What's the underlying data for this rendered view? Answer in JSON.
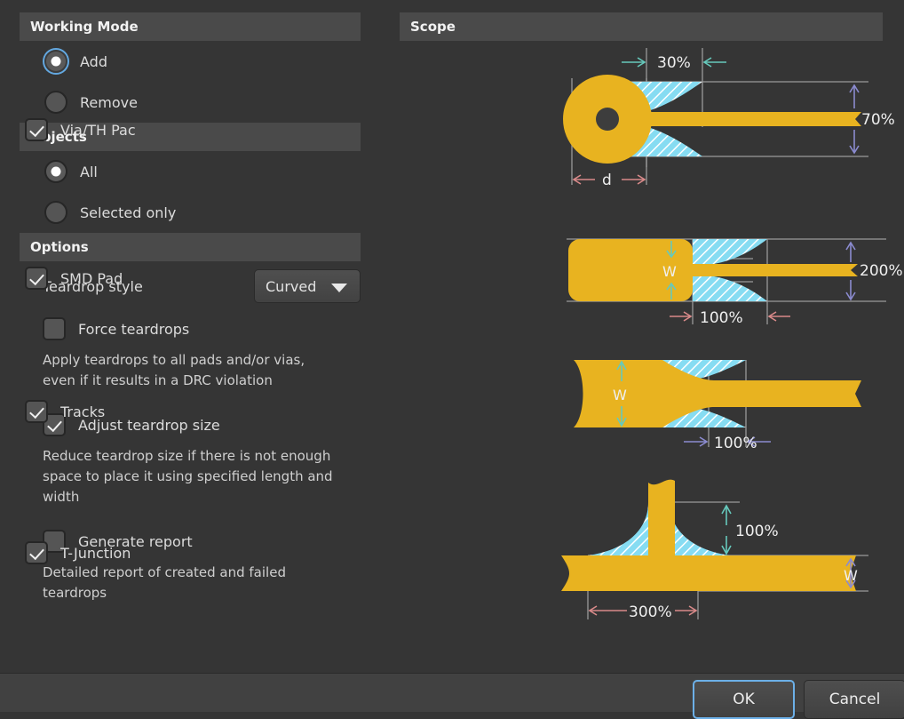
{
  "working_mode": {
    "header": "Working Mode",
    "options": [
      {
        "label": "Add",
        "selected": true,
        "focused": true
      },
      {
        "label": "Remove",
        "selected": false,
        "focused": false
      }
    ]
  },
  "objects": {
    "header": "Objects",
    "options": [
      {
        "label": "All",
        "selected": true,
        "focused": false
      },
      {
        "label": "Selected only",
        "selected": false,
        "focused": false
      }
    ]
  },
  "options": {
    "header": "Options",
    "teardrop_style": {
      "label": "Teardrop style",
      "value": "Curved",
      "caret_icon": "chevron-down-icon"
    },
    "force_teardrops": {
      "label": "Force teardrops",
      "checked": false,
      "help": "Apply teardrops to all pads and/or vias, even if it results in a DRC violation"
    },
    "adjust_teardrop_size": {
      "label": "Adjust teardrop size",
      "checked": true,
      "help": "Reduce teardrop size if there is not enough space to place it using specified length and width"
    },
    "generate_report": {
      "label": "Generate report",
      "checked": false,
      "help": "Detailed report of created and failed teardrops"
    }
  },
  "scope": {
    "header": "Scope",
    "items": [
      {
        "key": "via_th_pad",
        "label": "Via/TH Pac",
        "checked": true,
        "figure": "via-th-pad-diagram",
        "annotations": {
          "horizontal": "30%",
          "vertical": "70%",
          "diameter": "d"
        }
      },
      {
        "key": "smd_pad",
        "label": "SMD Pad",
        "checked": true,
        "figure": "smd-pad-diagram",
        "annotations": {
          "horizontal": "100%",
          "vertical": "200%",
          "width": "W"
        }
      },
      {
        "key": "tracks",
        "label": "Tracks",
        "checked": true,
        "figure": "tracks-diagram",
        "annotations": {
          "horizontal": "100%",
          "width": "W"
        }
      },
      {
        "key": "t_junction",
        "label": "T-Junction",
        "checked": true,
        "figure": "t-junction-diagram",
        "annotations": {
          "horizontal": "300%",
          "vertical": "100%",
          "width": "W"
        }
      }
    ]
  },
  "footer": {
    "ok_label": "OK",
    "cancel_label": "Cancel"
  },
  "colors": {
    "background": "#353535",
    "section_header": "#4a4a4a",
    "copper": "#e8b320",
    "teardrop_hatch": "#86dcf2",
    "accent_focus": "#6cb0e8",
    "dim_purple": "#8b8bd0",
    "dim_pink": "#d98a8a",
    "dim_teal": "#66c9bc",
    "dim_line": "#9a9a9a"
  }
}
